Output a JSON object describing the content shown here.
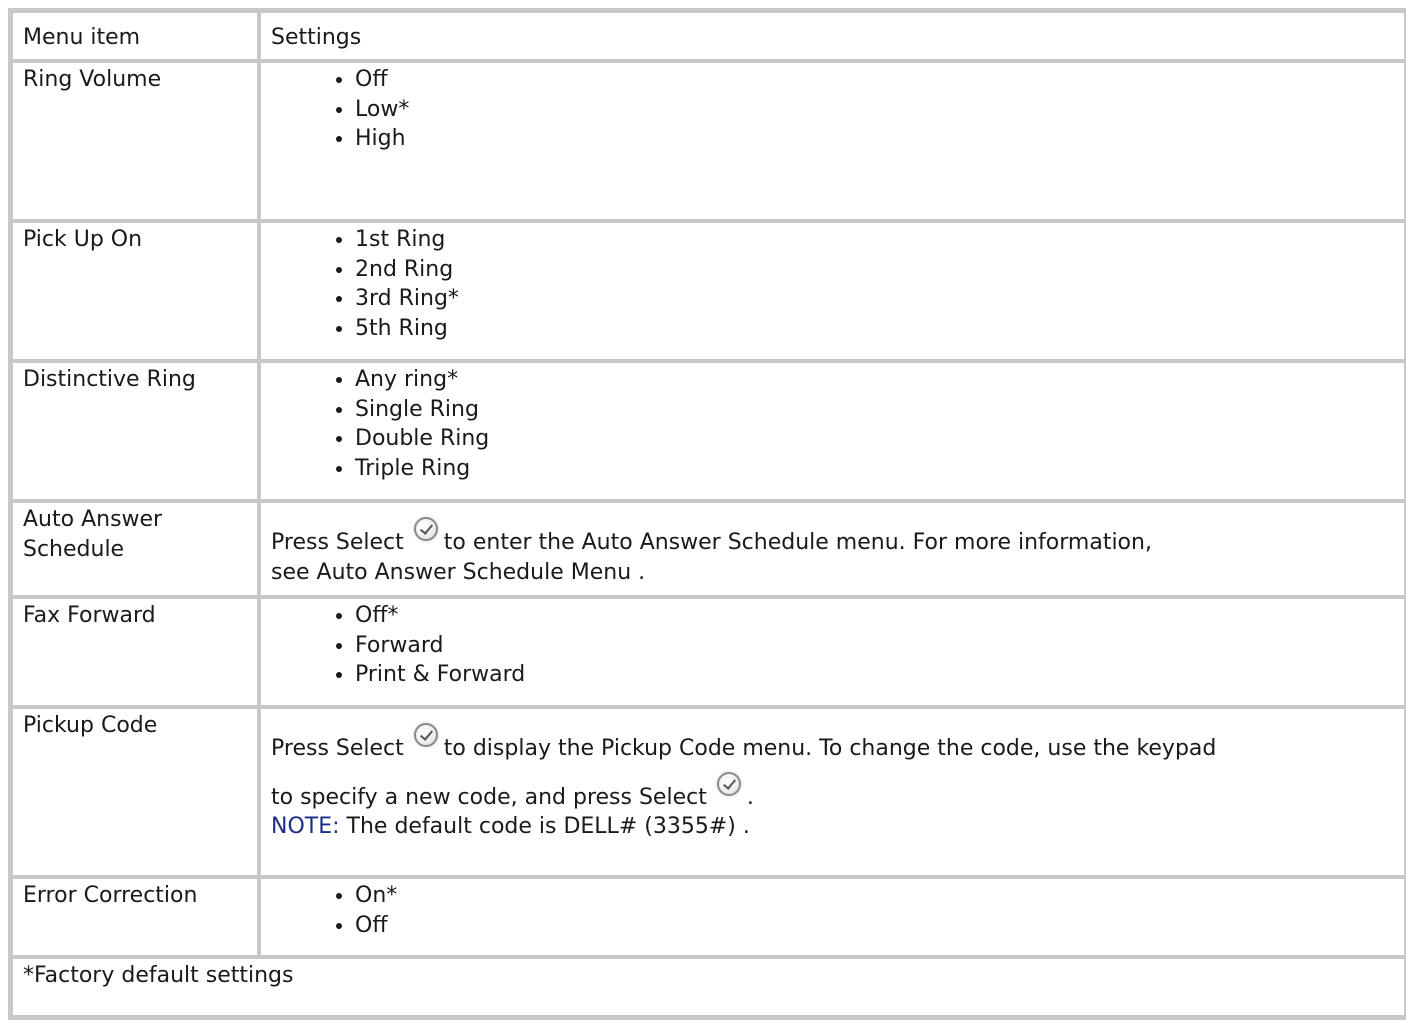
{
  "table": {
    "headers": [
      "Menu item",
      "Settings"
    ],
    "rows": {
      "ring_volume": {
        "label": "Ring Volume",
        "options": [
          "Off",
          "Low*",
          "High"
        ]
      },
      "pick_up_on": {
        "label": "Pick Up On",
        "options": [
          "1st Ring",
          "2nd Ring",
          "3rd Ring*",
          "5th Ring"
        ]
      },
      "distinctive_ring": {
        "label": "Distinctive Ring",
        "options": [
          "Any ring*",
          "Single Ring",
          "Double Ring",
          "Triple Ring"
        ]
      },
      "auto_answer": {
        "label_line1": "Auto Answer",
        "label_line2": "Schedule",
        "text_before": "Press Select",
        "text_after": "to enter the Auto Answer Schedule menu. For more information,",
        "text_line2_prefix": "see",
        "link": "Auto Answer Schedule Menu",
        "text_line2_suffix": "."
      },
      "fax_forward": {
        "label": "Fax Forward",
        "options": [
          "Off*",
          "Forward",
          "Print & Forward"
        ]
      },
      "pickup_code": {
        "label": "Pickup Code",
        "text_before": "Press Select",
        "text_after": "to display the Pickup Code menu. To change the code, use the keypad",
        "text_line2": "to specify a new code, and press Select",
        "text_line2_end": ".",
        "note_label": "NOTE:",
        "note_text": "The default code is DELL# (3355#) ."
      },
      "error_correction": {
        "label": "Error Correction",
        "options": [
          "On*",
          "Off"
        ]
      }
    },
    "footnote": "*Factory default settings"
  },
  "icons": {
    "select": "select-checkmark-icon"
  },
  "colors": {
    "border": "#c8c8c8",
    "note": "#1c2d8c",
    "text": "#1a1a1a"
  }
}
